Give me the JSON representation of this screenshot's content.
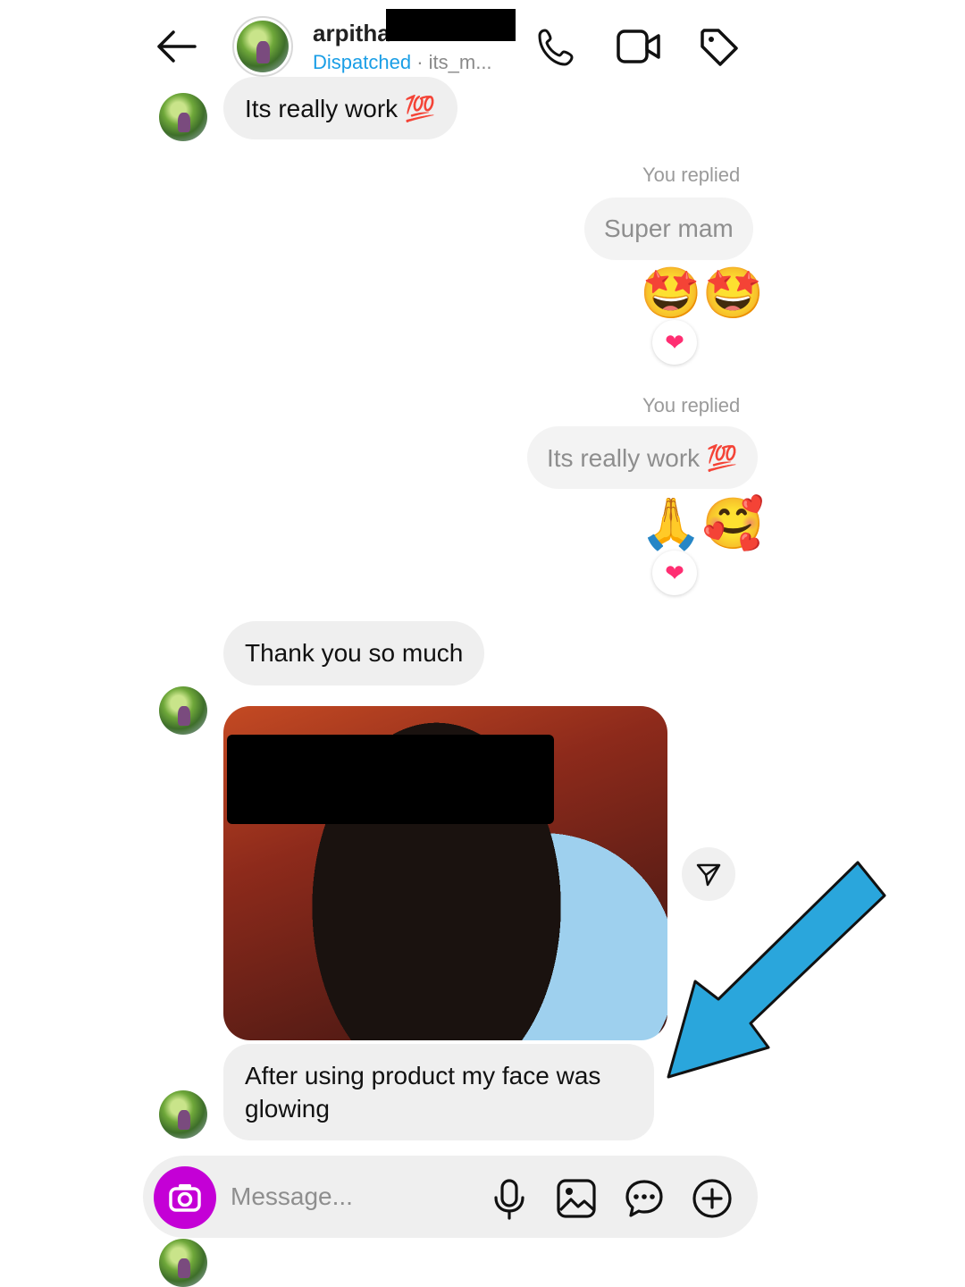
{
  "header": {
    "name": "arpitha",
    "status": "Dispatched",
    "separator": " · ",
    "handle": "its_m..."
  },
  "messages": {
    "m1": "Its really work 💯",
    "replied_1": "You replied",
    "reply_1": "Super mam",
    "emoji_1": "🤩🤩",
    "reaction_1": "❤",
    "replied_2": "You replied",
    "reply_2": "Its really work 💯",
    "emoji_2": "🙏🥰",
    "reaction_2": "❤",
    "m2": "Thank you so much",
    "m3": "After using product my face was glowing"
  },
  "composer": {
    "placeholder": "Message..."
  },
  "colors": {
    "status_blue": "#1a9ee6",
    "camera_purple": "#c400d6",
    "arrow_blue": "#2aa6dc",
    "heart_pink": "#ff2e72"
  }
}
